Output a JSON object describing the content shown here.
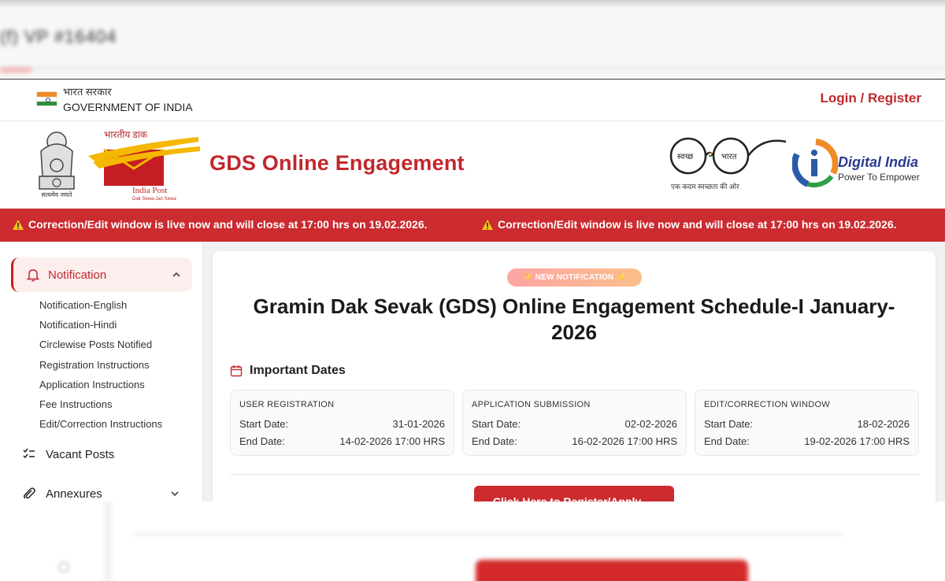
{
  "background": {
    "blurred_text": "(f) VP #16404"
  },
  "gov_bar": {
    "hindi_label": "भारत सरकार",
    "english_label": "GOVERNMENT OF INDIA",
    "login_label": "Login / Register"
  },
  "brand": {
    "emblem_motto": "सत्यमेव जयते",
    "india_post_hindi": "भारतीय डाक",
    "india_post_label": "India Post",
    "india_post_tagline": "Dak Sewa-Jan Sewa",
    "site_title": "GDS Online Engagement",
    "swachh_left": "स्वच्छ",
    "swachh_right": "भारत",
    "swachh_caption": "एक कदम स्वच्छता की ओर",
    "digital_india_title": "Digital India",
    "digital_india_sub": "Power To Empower"
  },
  "ticker": {
    "message": "Correction/Edit window is live now and will close at 17:00 hrs on 19.02.2026."
  },
  "sidebar": {
    "active_label": "Notification",
    "sub_items": [
      "Notification-English",
      "Notification-Hindi",
      "Circlewise Posts Notified",
      "Registration Instructions",
      "Application Instructions",
      "Fee Instructions",
      "Edit/Correction Instructions"
    ],
    "vacant_posts": "Vacant Posts",
    "annexures": "Annexures"
  },
  "main": {
    "badge": "✨ NEW NOTIFICATION ✨",
    "title": "Gramin Dak Sevak (GDS) Online Engagement Schedule-I January-2026",
    "important_dates_heading": "Important Dates",
    "start_label": "Start Date:",
    "end_label": "End Date:",
    "date_boxes": [
      {
        "heading": "USER REGISTRATION",
        "start": "31-01-2026",
        "end": "14-02-2026 17:00 HRS"
      },
      {
        "heading": "APPLICATION SUBMISSION",
        "start": "02-02-2026",
        "end": "16-02-2026 17:00 HRS"
      },
      {
        "heading": "EDIT/CORRECTION WINDOW",
        "start": "18-02-2026",
        "end": "19-02-2026 17:00 HRS"
      }
    ],
    "cta_label": "Click Here to Register/Apply →"
  },
  "colors": {
    "brand_red": "#c1272d",
    "ticker_red": "#cc2b2f",
    "digital_india_blue": "#2a3b8f"
  }
}
